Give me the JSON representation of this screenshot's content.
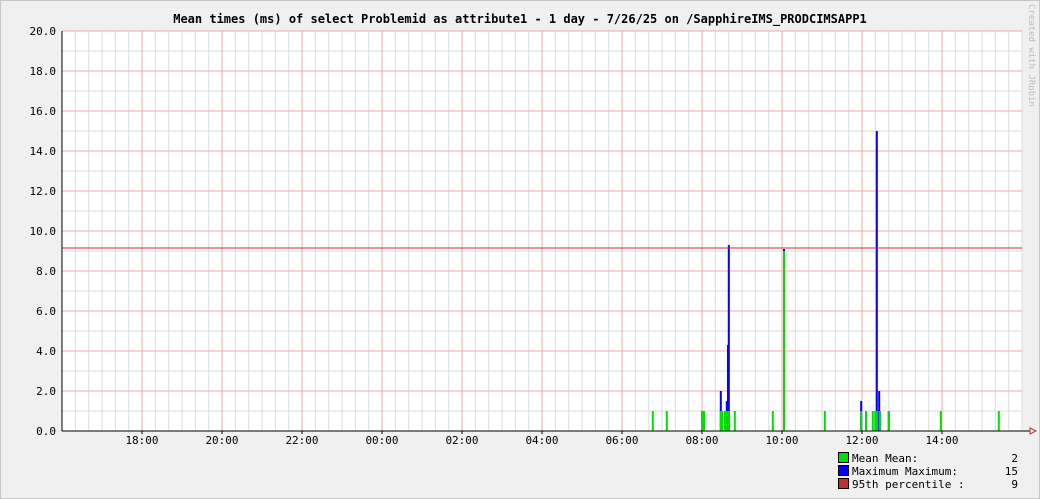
{
  "colors": {
    "mean": "#00e000",
    "maximum": "#0000ff",
    "percentile": "#c03030",
    "major_grid": "#f0a8a8",
    "minor_grid": "#dcdcdc",
    "plot_bg": "#ffffff"
  },
  "chart_data": {
    "type": "bar",
    "title": "Mean times (ms) of select Problemid as attribute1 - 1 day - 7/26/25 on /SapphireIMS_PRODCIMSAPP1",
    "watermark": "Created with JRobin",
    "xlabel": "",
    "ylabel": "",
    "ylim": [
      0,
      20
    ],
    "y_ticks": [
      "0.0",
      "2.0",
      "4.0",
      "6.0",
      "8.0",
      "10.0",
      "12.0",
      "14.0",
      "16.0",
      "18.0",
      "20.0"
    ],
    "x_axis": {
      "range_hours": [
        16.0,
        40.0
      ],
      "ticks": [
        {
          "hour": 18,
          "label": "18:00"
        },
        {
          "hour": 20,
          "label": "20:00"
        },
        {
          "hour": 22,
          "label": "22:00"
        },
        {
          "hour": 24,
          "label": "00:00"
        },
        {
          "hour": 26,
          "label": "02:00"
        },
        {
          "hour": 28,
          "label": "04:00"
        },
        {
          "hour": 30,
          "label": "06:00"
        },
        {
          "hour": 32,
          "label": "08:00"
        },
        {
          "hour": 34,
          "label": "10:00"
        },
        {
          "hour": 36,
          "label": "12:00"
        },
        {
          "hour": 38,
          "label": "14:00"
        }
      ]
    },
    "grid": true,
    "series": [
      {
        "name": "Maximum",
        "points": [
          {
            "hour": 32.47,
            "value": 2
          },
          {
            "hour": 32.62,
            "value": 1.5
          },
          {
            "hour": 32.65,
            "value": 4.3
          },
          {
            "hour": 32.67,
            "value": 9.3
          },
          {
            "hour": 34.05,
            "value": 9.1
          },
          {
            "hour": 35.98,
            "value": 1.5
          },
          {
            "hour": 36.37,
            "value": 15
          },
          {
            "hour": 36.43,
            "value": 2
          },
          {
            "hour": 36.67,
            "value": 1
          }
        ]
      },
      {
        "name": "Mean",
        "points": [
          {
            "hour": 30.77,
            "value": 1
          },
          {
            "hour": 31.12,
            "value": 1
          },
          {
            "hour": 32.0,
            "value": 1
          },
          {
            "hour": 32.05,
            "value": 1
          },
          {
            "hour": 32.47,
            "value": 1
          },
          {
            "hour": 32.5,
            "value": 1
          },
          {
            "hour": 32.57,
            "value": 1
          },
          {
            "hour": 32.62,
            "value": 1
          },
          {
            "hour": 32.67,
            "value": 1
          },
          {
            "hour": 32.82,
            "value": 1
          },
          {
            "hour": 33.77,
            "value": 1
          },
          {
            "hour": 34.05,
            "value": 9
          },
          {
            "hour": 35.07,
            "value": 1
          },
          {
            "hour": 35.98,
            "value": 1
          },
          {
            "hour": 36.1,
            "value": 1
          },
          {
            "hour": 36.27,
            "value": 1
          },
          {
            "hour": 36.33,
            "value": 1
          },
          {
            "hour": 36.37,
            "value": 1
          },
          {
            "hour": 36.45,
            "value": 1
          },
          {
            "hour": 36.67,
            "value": 1
          },
          {
            "hour": 37.97,
            "value": 1
          },
          {
            "hour": 39.42,
            "value": 1
          }
        ]
      }
    ],
    "percentile_95": 9.15,
    "legend": [
      {
        "label": "Mean  Mean:",
        "value": "2",
        "color": "#00e000"
      },
      {
        "label": "Maximum  Maximum:",
        "value": "15",
        "color": "#0000ff"
      },
      {
        "label": "95th percentile  :",
        "value": "9",
        "color": "#c03030"
      }
    ]
  }
}
